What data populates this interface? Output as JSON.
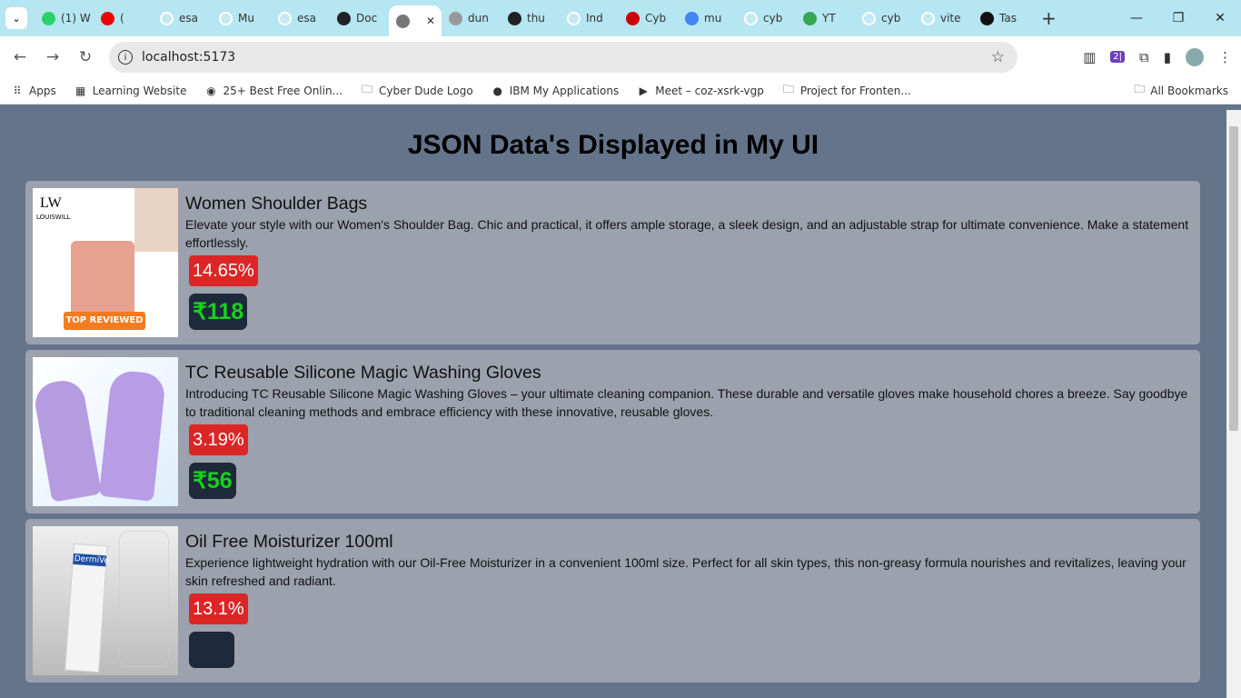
{
  "browser": {
    "tabs": [
      {
        "label": "(1) W",
        "icon": "whatsapp-icon",
        "color": "#25d366"
      },
      {
        "label": "(",
        "icon": "youtube-icon",
        "color": "#e00"
      },
      {
        "label": "esa",
        "icon": "github-icon",
        "color": "#fff"
      },
      {
        "label": "Mu",
        "icon": "github-icon",
        "color": "#fff"
      },
      {
        "label": "esa",
        "icon": "github-icon",
        "color": "#fff"
      },
      {
        "label": "Doc",
        "icon": "record-icon",
        "color": "#222"
      },
      {
        "label": "",
        "icon": "globe-icon",
        "color": "#777",
        "active": true
      },
      {
        "label": "dun",
        "icon": "globe-icon",
        "color": "#999"
      },
      {
        "label": "thu",
        "icon": "record-icon",
        "color": "#222"
      },
      {
        "label": "Ind",
        "icon": "github-icon",
        "color": "#fff"
      },
      {
        "label": "Cyb",
        "icon": "target-icon",
        "color": "#c00"
      },
      {
        "label": "mu",
        "icon": "google-icon",
        "color": "#4285f4"
      },
      {
        "label": "cyb",
        "icon": "github-icon",
        "color": "#fff"
      },
      {
        "label": "YT",
        "icon": "sheets-icon",
        "color": "#34a853"
      },
      {
        "label": "cyb",
        "icon": "github-icon",
        "color": "#fff"
      },
      {
        "label": "vite",
        "icon": "github-icon",
        "color": "#fff"
      },
      {
        "label": "Tas",
        "icon": "github-icon",
        "color": "#111"
      }
    ],
    "url": "localhost:5173",
    "bookmarks": [
      {
        "label": "Apps",
        "icon": "apps-grid-icon"
      },
      {
        "label": "Learning Website",
        "icon": "css-grid-icon"
      },
      {
        "label": "25+ Best Free Onlin...",
        "icon": "site-icon"
      },
      {
        "label": "Cyber Dude Logo",
        "icon": "folder-icon"
      },
      {
        "label": "IBM My Applications",
        "icon": "globe-icon"
      },
      {
        "label": "Meet – coz-xsrk-vgp",
        "icon": "meet-icon"
      },
      {
        "label": "Project for Fronten...",
        "icon": "folder-icon"
      }
    ],
    "all_bookmarks": "All Bookmarks"
  },
  "page": {
    "title": "JSON Data's Displayed in My UI",
    "products": [
      {
        "title": "Women Shoulder Bags",
        "description": "Elevate your style with our Women's Shoulder Bag. Chic and practical, it offers ample storage, a sleek design, and an adjustable strap for ultimate convenience. Make a statement effortlessly.",
        "discount": "14.65%",
        "price": "₹118",
        "image_text": "LOUISWILL TOP REVIEWED"
      },
      {
        "title": "TC Reusable Silicone Magic Washing Gloves",
        "description": "Introducing TC Reusable Silicone Magic Washing Gloves – your ultimate cleaning companion. These durable and versatile gloves make household chores a breeze. Say goodbye to traditional cleaning methods and embrace efficiency with these innovative, reusable gloves.",
        "discount": "3.19%",
        "price": "₹56"
      },
      {
        "title": "Oil Free Moisturizer 100ml",
        "description": "Experience lightweight hydration with our Oil-Free Moisturizer in a convenient 100ml size. Perfect for all skin types, this non-greasy formula nourishes and revitalizes, leaving your skin refreshed and radiant.",
        "discount": "13.1%",
        "price": "",
        "image_text": "DermiVe"
      }
    ]
  },
  "colors": {
    "page_bg": "#64748b",
    "card_bg": "#9ba1ad",
    "discount_bg": "#dc2626",
    "price_bg": "#1e293b",
    "price_text": "#16d31c"
  }
}
